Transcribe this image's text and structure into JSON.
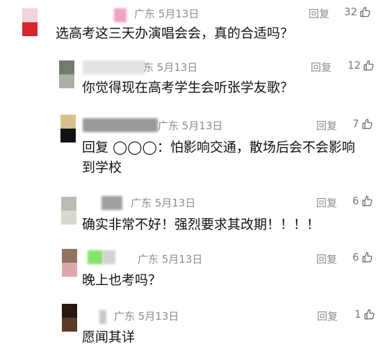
{
  "comments": [
    {
      "avatar_colors": [
        "#f3d3de",
        "#d8262f"
      ],
      "region": "广东",
      "date": "5月13日",
      "reply_label": "回复",
      "likes": "32",
      "text": "选高考这三天办演唱会会，真的合适吗？"
    },
    {
      "avatar_colors": [
        "#6f7d6a",
        "#a9b0a4"
      ],
      "region": "东",
      "date": "5月13日",
      "reply_label": "回复",
      "likes": "12",
      "text": "你觉得现在高考学生会听张学友歌？"
    },
    {
      "avatar_colors": [
        "#d8c08e",
        "#111111"
      ],
      "region": "广东",
      "date": "5月13日",
      "reply_label": "回复",
      "likes": "7",
      "text_line1": "回复 ◯◯◯：怕影响交通，散场后会不会影响",
      "text_line2": "到学校"
    },
    {
      "avatar_colors": [
        "#b9bdb3",
        "#d9d8d2"
      ],
      "region": "广东",
      "date": "5月13日",
      "reply_label": "回复",
      "likes": "6",
      "text": "确实非常不好！强烈要求其改期！！！！"
    },
    {
      "avatar_colors": [
        "#8e7562",
        "#e0a6ae"
      ],
      "region": "广东",
      "date": "5月13日",
      "reply_label": "回复",
      "likes": "6",
      "text": "晚上也考吗？"
    },
    {
      "avatar_colors": [
        "#2a1712",
        "#5a3a2a"
      ],
      "region": "广东",
      "date": "5月13日",
      "reply_label": "回复",
      "likes": "1",
      "text": "愿闻其详"
    }
  ],
  "icons": {
    "like": "thumbs-up-icon"
  }
}
